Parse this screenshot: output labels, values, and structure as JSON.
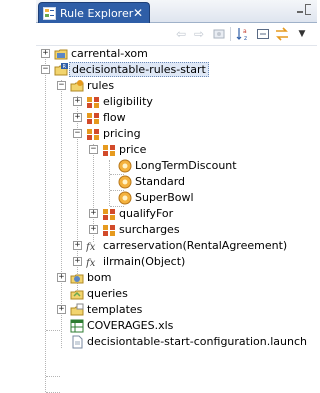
{
  "view": {
    "tab_label": "Rule Explorer",
    "tab_close": "✕"
  },
  "toolbar": {
    "back": "⇦",
    "forward": "⇨",
    "sort_label": "↓a z",
    "menu": "▼"
  },
  "tree": {
    "carrental_xom": "carrental-xom",
    "project": "decisiontable-rules-start",
    "rules": "rules",
    "eligibility": "eligibility",
    "flow": "flow",
    "pricing": "pricing",
    "price": "price",
    "long_term_discount": "LongTermDiscount",
    "standard": "Standard",
    "superbowl": "SuperBowl",
    "qualify_for": "qualifyFor",
    "surcharges": "surcharges",
    "carreservation": "carreservation(RentalAgreement)",
    "ilrmain": "ilrmain(Object)",
    "bom": "bom",
    "queries": "queries",
    "templates": "templates",
    "coverages": "COVERAGES.xls",
    "launch": "decisiontable-start-configuration.launch"
  }
}
